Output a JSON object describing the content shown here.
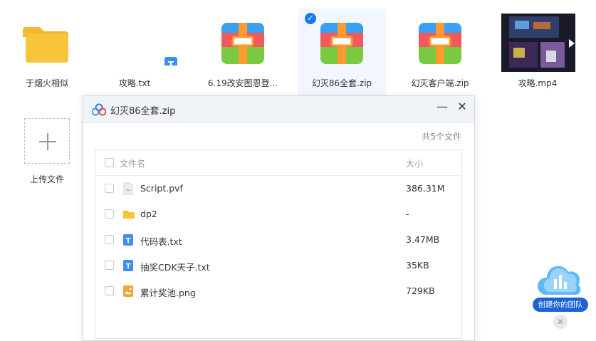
{
  "files": [
    {
      "name": "于烟火相似",
      "icon": "folder-icon"
    },
    {
      "name": "攻略.txt",
      "icon": "txt-doc-icon"
    },
    {
      "name": "6.19改安图恩登...",
      "icon": "zip-archive-icon"
    },
    {
      "name": "幻灭86全套.zip",
      "icon": "zip-archive-icon",
      "selected": true
    },
    {
      "name": "幻灭客户端.zip",
      "icon": "zip-archive-icon"
    },
    {
      "name": "攻略.mp4",
      "icon": "video-thumbnail-icon"
    }
  ],
  "upload": {
    "label": "上传文件"
  },
  "modal": {
    "title": "幻灭86全套.zip",
    "minimize": "—",
    "close": "✕",
    "count": "共5个文件",
    "columns": {
      "name": "文件名",
      "size": "大小"
    },
    "rows": [
      {
        "name": "Script.pvf",
        "size": "386.31M",
        "icon": "generic-file-icon"
      },
      {
        "name": "dp2",
        "size": "-",
        "icon": "folder-icon"
      },
      {
        "name": "代码表.txt",
        "size": "3.47MB",
        "icon": "txt-doc-icon"
      },
      {
        "name": "抽奖CDK天子.txt",
        "size": "35KB",
        "icon": "txt-doc-icon"
      },
      {
        "name": "累计奖池.png",
        "size": "729KB",
        "icon": "image-file-icon"
      }
    ]
  },
  "team": {
    "label": "创建你的团队",
    "close": "✕"
  },
  "colors": {
    "accent": "#1677ff",
    "folder": "#f8c53a",
    "zip_red": "#f05a5a",
    "zip_green": "#7ac943",
    "zip_orange": "#ff9a2e",
    "zip_blue": "#3aa0f3"
  }
}
